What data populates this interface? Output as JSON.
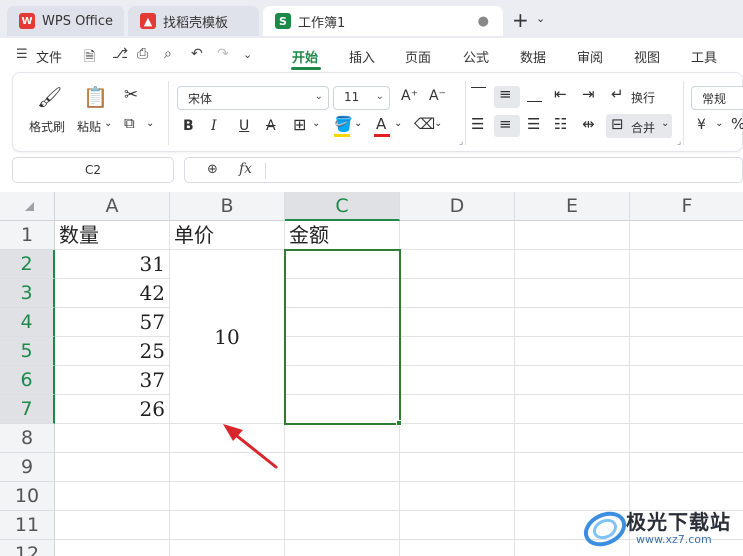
{
  "tabs": [
    {
      "label": "WPS Office",
      "icon": "wps-logo-icon",
      "active": false
    },
    {
      "label": "找稻壳模板",
      "icon": "daoke-logo-icon",
      "active": false
    },
    {
      "label": "工作簿1",
      "icon": "spreadsheet-s-icon",
      "active": true,
      "logo_letter": "S"
    }
  ],
  "menu": {
    "file_label": "文件",
    "items": [
      "开始",
      "插入",
      "页面",
      "公式",
      "数据",
      "审阅",
      "视图",
      "工具"
    ],
    "active": "开始"
  },
  "ribbon": {
    "format_painter": "格式刷",
    "paste": "粘贴",
    "font_name": "宋体",
    "font_size": "11",
    "bold": "B",
    "italic": "I",
    "underline": "U",
    "strikethrough": "A",
    "font_color_letter": "A",
    "wrap_text": "换行",
    "merge": "合并",
    "number_format": "常规",
    "currency_symbol": "¥",
    "highlight_color": "#f6d800",
    "font_color": "#e02020"
  },
  "formula_bar": {
    "name_box": "C2",
    "fx_label": "fx",
    "content": ""
  },
  "sheet": {
    "columns": [
      "A",
      "B",
      "C",
      "D",
      "E",
      "F"
    ],
    "rows": [
      "1",
      "2",
      "3",
      "4",
      "5",
      "6",
      "7",
      "8",
      "9",
      "10",
      "11",
      "12"
    ],
    "selected_column": "C",
    "selected_rows": [
      "2",
      "3",
      "4",
      "5",
      "6",
      "7"
    ],
    "headers": {
      "A1": "数量",
      "B1": "单价",
      "C1": "金额"
    },
    "quantities": [
      "31",
      "42",
      "57",
      "25",
      "37",
      "26"
    ],
    "unit_price_merged": "10",
    "selection_range": "C2:C7"
  },
  "watermark": {
    "title": "极光下载站",
    "url": "www.xz7.com"
  },
  "colors": {
    "accent_green": "#1e8a4a",
    "selection_border": "#2e7d32",
    "annotation_arrow": "#d9262b"
  }
}
